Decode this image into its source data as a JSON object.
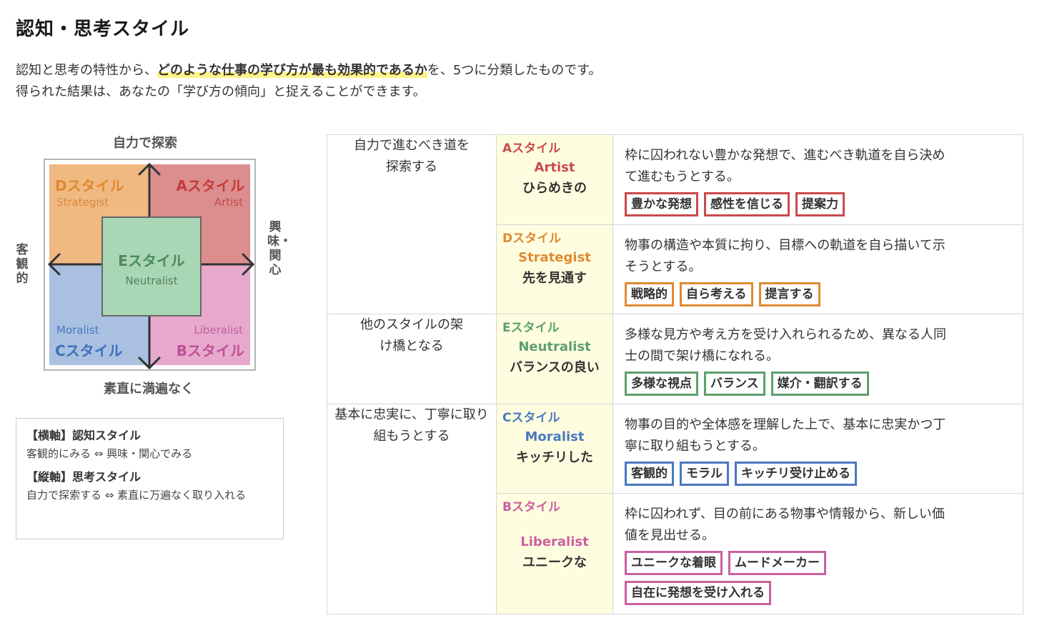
{
  "page": {
    "title": "認知・思考スタイル",
    "intro_pre": "認知と思考の特性から、",
    "intro_highlight": "どのような仕事の学び方が最も効果的であるか",
    "intro_post": "を、5つに分類したものです。",
    "intro_line2": "得られた結果は、あなたの「学び方の傾向」と捉えることができます。"
  },
  "diagram": {
    "axis_top": "自力で探索",
    "axis_bottom": "素直に満遍なく",
    "axis_left": "客観的",
    "axis_right": "興味・関心",
    "quadrants": {
      "d": {
        "title": "Dスタイル",
        "sub": "Strategist"
      },
      "a": {
        "title": "Aスタイル",
        "sub": "Artist"
      },
      "c": {
        "title": "Cスタイル",
        "sub": "Moralist"
      },
      "b": {
        "title": "Bスタイル",
        "sub": "Liberalist"
      },
      "e": {
        "title": "Eスタイル",
        "sub": "Neutralist"
      }
    },
    "colors": {
      "d": "#f0b982",
      "a": "#dc8e8e",
      "c": "#a9c0e0",
      "b": "#e6a9cc",
      "e": "#a9d6b4"
    }
  },
  "axis_box": {
    "h_title": "【横軸】認知スタイル",
    "h_desc": "客観的にみる ⇔ 興味・関心でみる",
    "v_title": "【縦軸】思考スタイル",
    "v_desc": "自力で探索する ⇔ 素直に万遍なく取り入れる"
  },
  "table": {
    "groups": [
      "自力で進むべき道を探索する",
      "他のスタイルの架け橋となる",
      "基本に忠実に、丁寧に取り組もうとする"
    ],
    "rows": [
      {
        "style": "Aスタイル",
        "eng": "Artist",
        "jp": "ひらめきの",
        "color": "#c94a4a",
        "desc": "枠に囚われない豊かな発想で、進むべき軌道を自ら決めて進むもうとする。",
        "tags": [
          "豊かな発想",
          "感性を信じる",
          "提案力"
        ]
      },
      {
        "style": "Dスタイル",
        "eng": "Strategist",
        "jp": "先を見通す",
        "color": "#e08a32",
        "desc": "物事の構造や本質に拘り、目標への軌道を自ら描いて示そうとする。",
        "tags": [
          "戦略的",
          "自ら考える",
          "提言する"
        ]
      },
      {
        "style": "Eスタイル",
        "eng": "Neutralist",
        "jp": "バランスの良い",
        "color": "#5da06e",
        "desc": "多様な見方や考え方を受け入れられるため、異なる人同士の間で架け橋になれる。",
        "tags": [
          "多様な視点",
          "バランス",
          "媒介・翻訳する"
        ]
      },
      {
        "style": "Cスタイル",
        "eng": "Moralist",
        "jp": "キッチリした",
        "color": "#4a78c0",
        "desc": "物事の目的や全体感を理解した上で、基本に忠実かつ丁寧に取り組もうとする。",
        "tags": [
          "客観的",
          "モラル",
          "キッチリ受け止める"
        ]
      },
      {
        "style": "Bスタイル",
        "eng": "Liberalist",
        "jp": "ユニークな",
        "color": "#c960a0",
        "desc": "枠に囚われず、目の前にある物事や情報から、新しい価値を見出せる。",
        "tags": [
          "ユニークな着眼",
          "ムードメーカー",
          "自在に発想を受け入れる"
        ]
      }
    ]
  }
}
